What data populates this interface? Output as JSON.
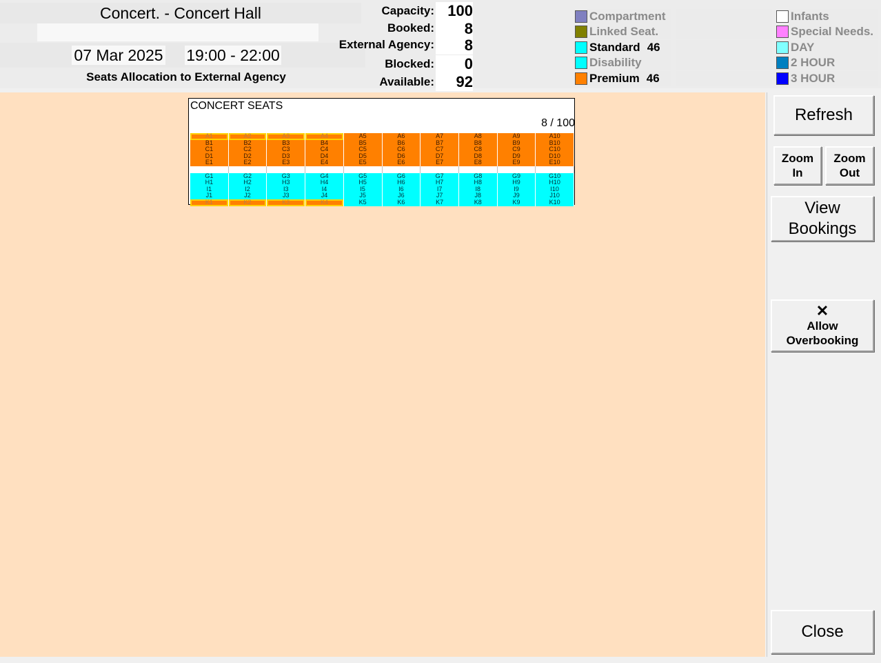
{
  "header": {
    "title": "Concert. - Concert Hall",
    "subtitle": "",
    "date": "07 Mar 2025",
    "time": "19:00 - 22:00",
    "caption": "Seats Allocation to External Agency"
  },
  "stats": {
    "capacity_label": "Capacity:",
    "capacity": "100",
    "booked_label": "Booked:",
    "booked": "8",
    "external_label": "External Agency:",
    "external": "8",
    "blocked_label": "Blocked:",
    "blocked": "0",
    "available_label": "Available:",
    "available": "92"
  },
  "legend": {
    "left": [
      {
        "label": "Compartment",
        "count": "",
        "color": "#8080c0",
        "dim": true
      },
      {
        "label": "Linked Seat.",
        "count": "",
        "color": "#808000",
        "dim": true
      },
      {
        "label": "Standard",
        "count": "46",
        "color": "#00ffff",
        "dim": false
      },
      {
        "label": "Disability",
        "count": "",
        "color": "#00ffff",
        "dim": true
      },
      {
        "label": "Premium",
        "count": "46",
        "color": "#ff8000",
        "dim": false
      }
    ],
    "right": [
      {
        "label": "Infants",
        "color": "#ffffff"
      },
      {
        "label": "Special Needs.",
        "color": "#ff80ff"
      },
      {
        "label": "DAY",
        "color": "#80ffff"
      },
      {
        "label": "2 HOUR",
        "color": "#0080c0"
      },
      {
        "label": "3 HOUR",
        "color": "#0000ff"
      }
    ]
  },
  "seatmap": {
    "title": "CONCERT SEATS",
    "count": "8 / 100",
    "columns": 10,
    "rows": [
      {
        "row": "A",
        "type": "prem",
        "ext": [
          1,
          2,
          3,
          4
        ]
      },
      {
        "row": "B",
        "type": "prem",
        "ext": []
      },
      {
        "row": "C",
        "type": "prem",
        "ext": []
      },
      {
        "row": "D",
        "type": "prem",
        "ext": []
      },
      {
        "row": "E",
        "type": "prem",
        "ext": []
      },
      {
        "row": "",
        "type": "gap",
        "ext": []
      },
      {
        "row": "G",
        "type": "std",
        "ext": []
      },
      {
        "row": "H",
        "type": "std",
        "ext": []
      },
      {
        "row": "I",
        "type": "std",
        "ext": []
      },
      {
        "row": "J",
        "type": "std",
        "ext": []
      },
      {
        "row": "K",
        "type": "std",
        "ext": [
          1,
          2,
          3,
          4
        ]
      }
    ]
  },
  "sidebar": {
    "refresh": "Refresh",
    "zoom_in_1": "Zoom",
    "zoom_in_2": "In",
    "zoom_out_1": "Zoom",
    "zoom_out_2": "Out",
    "view_1": "View",
    "view_2": "Bookings",
    "overbook_icon": "✕",
    "overbook_1": "Allow",
    "overbook_2": "Overbooking",
    "close": "Close"
  }
}
